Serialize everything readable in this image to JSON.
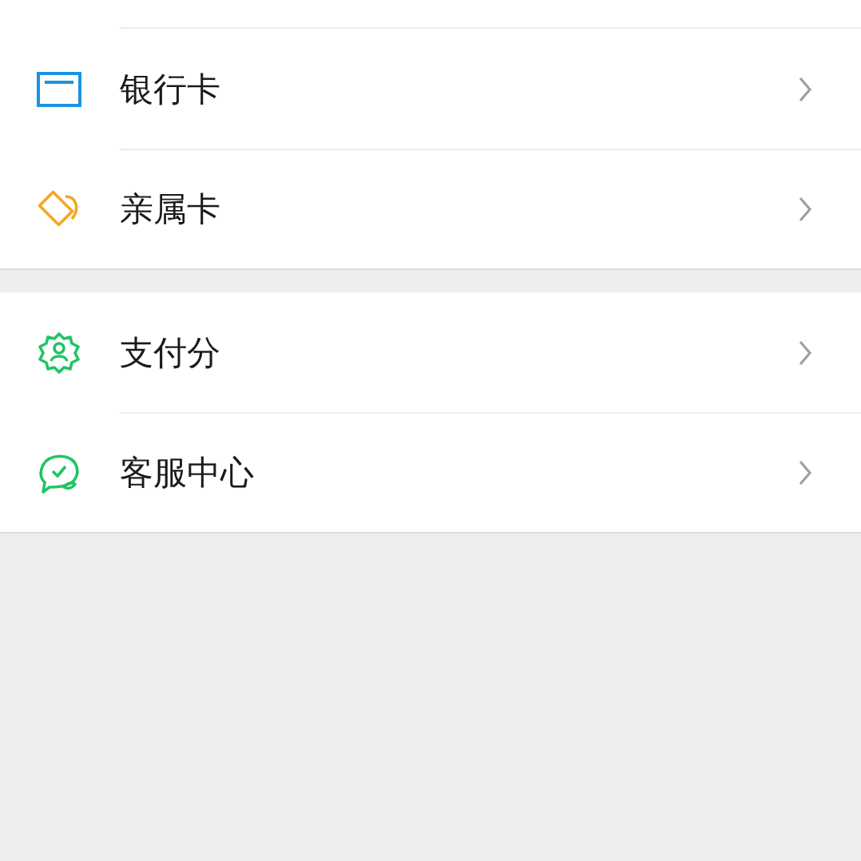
{
  "groups": [
    {
      "items": [
        {
          "kind": "card",
          "label": "银行卡"
        },
        {
          "kind": "family",
          "label": "亲属卡"
        }
      ]
    },
    {
      "items": [
        {
          "kind": "score",
          "label": "支付分"
        },
        {
          "kind": "service",
          "label": "客服中心"
        }
      ]
    }
  ]
}
